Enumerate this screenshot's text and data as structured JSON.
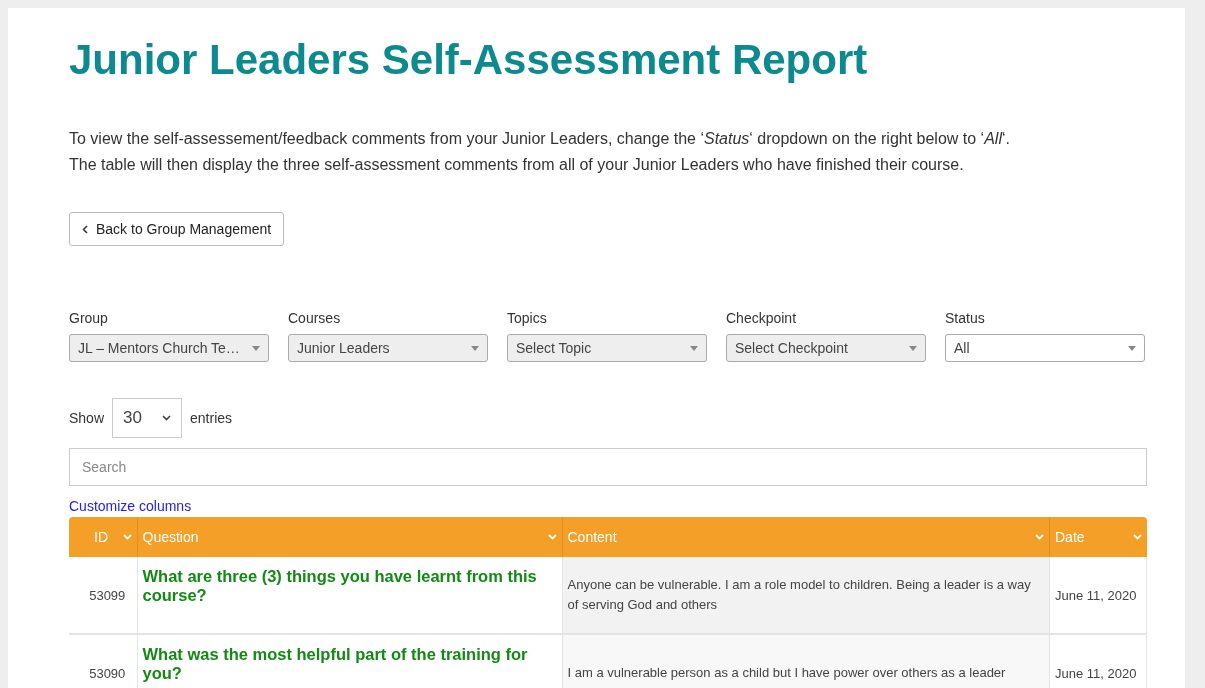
{
  "title": "Junior Leaders Self-Assessment Report",
  "intro": [
    "To view the self-assessement/feedback comments from your Junior Leaders, change the ‘*Status*‘ dropdown on the right below to ‘*All*‘.",
    "The table will then display the three self-assessment comments from all of your Junior Leaders who have finished their course."
  ],
  "back_button": {
    "label": "Back to Group Management"
  },
  "filters": [
    {
      "label": "Group",
      "value": "JL – Mentors Church Te…",
      "disabled": true
    },
    {
      "label": "Courses",
      "value": "Junior Leaders",
      "disabled": true
    },
    {
      "label": "Topics",
      "value": "Select Topic",
      "disabled": true
    },
    {
      "label": "Checkpoint",
      "value": "Select Checkpoint",
      "disabled": true
    },
    {
      "label": "Status",
      "value": "All",
      "disabled": false
    }
  ],
  "entries": {
    "before": "Show",
    "value": "30",
    "after": "entries"
  },
  "search": {
    "placeholder": "Search"
  },
  "customize_link": "Customize columns",
  "table": {
    "columns": [
      {
        "label": "ID",
        "kind": "id"
      },
      {
        "label": "Question",
        "kind": "question"
      },
      {
        "label": "Content",
        "kind": "content"
      },
      {
        "label": "Date",
        "kind": "date"
      }
    ],
    "rows": [
      {
        "cells": [
          "53099",
          "What are three (3) things you have learnt from this course?",
          "Anyone can be vulnerable. I am a role model to children. Being a leader is a way of serving God and others",
          "June 11, 2020"
        ]
      },
      {
        "cells": [
          "53090",
          "What was the most helpful part of the training for you?",
          "I am a vulnerable person as a child but I have power over others as a leader",
          "June 11, 2020"
        ]
      }
    ]
  }
}
